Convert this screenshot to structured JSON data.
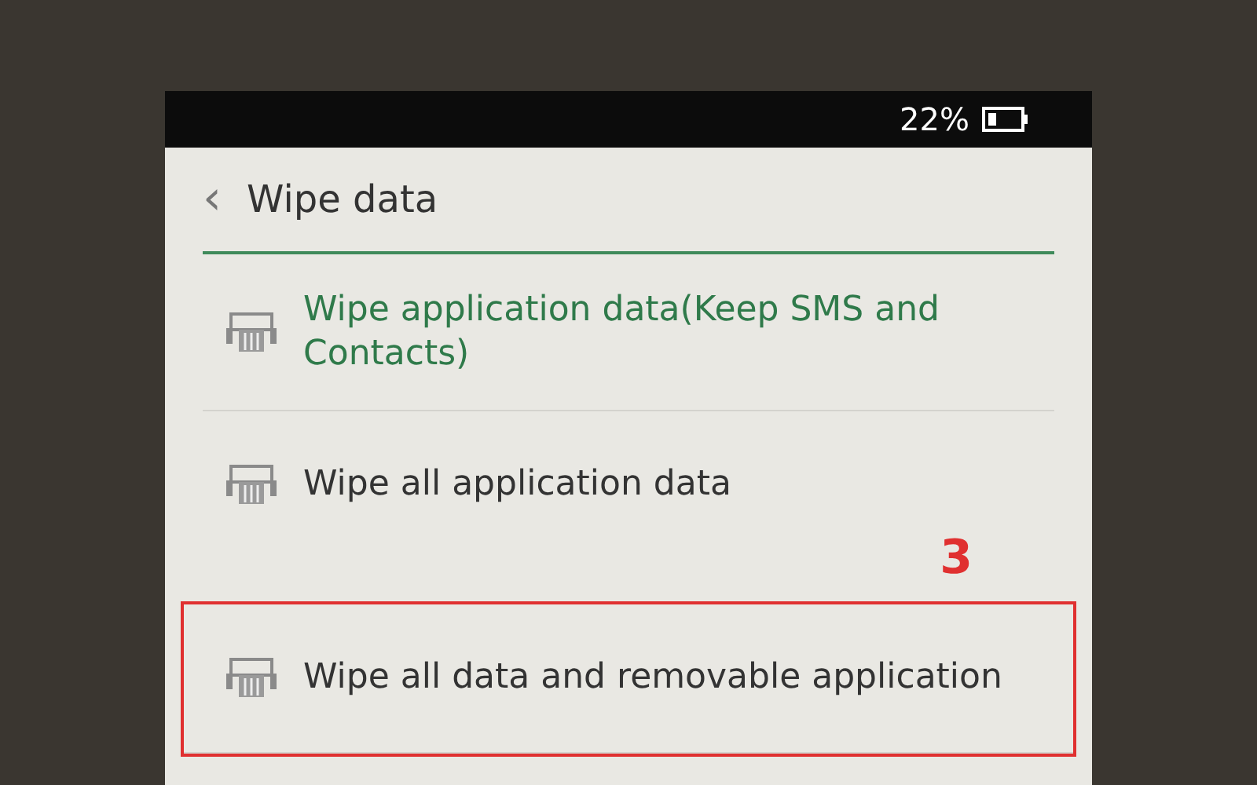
{
  "status_bar": {
    "battery": "22%"
  },
  "header": {
    "back": "‹",
    "title": "Wipe data"
  },
  "options": [
    {
      "label": "Wipe application data(Keep SMS and Contacts)",
      "selected": true,
      "highlighted": false
    },
    {
      "label": "Wipe all application data",
      "selected": false,
      "highlighted": false
    },
    {
      "label": "Wipe all data and removable application",
      "selected": false,
      "highlighted": true
    }
  ],
  "annotation": {
    "label": "3"
  }
}
